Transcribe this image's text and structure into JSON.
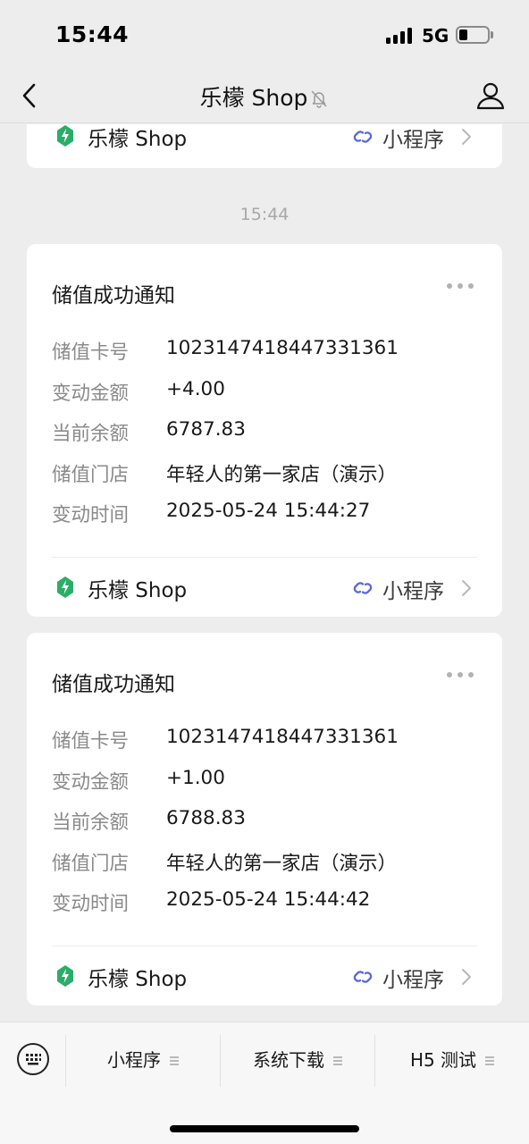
{
  "status_bar": {
    "time": "15:44",
    "network": "5G",
    "icons": [
      "signal-icon",
      "battery-icon"
    ]
  },
  "nav": {
    "title": "乐檬 Shop",
    "icons": [
      "back-icon",
      "mute-bell-icon",
      "person-icon"
    ]
  },
  "chat": {
    "top_card": {
      "miniprogram_name": "乐檬 Shop",
      "miniprogram_tag": "小程序"
    },
    "timestamp": "15:44",
    "messages": [
      {
        "title": "储值成功通知",
        "fields": [
          {
            "label": "储值卡号",
            "value": "1023147418447331361"
          },
          {
            "label": "变动金额",
            "value": "+4.00"
          },
          {
            "label": "当前余额",
            "value": "6787.83"
          },
          {
            "label": "储值门店",
            "value": "年轻人的第一家店（演示）"
          },
          {
            "label": "变动时间",
            "value": "2025-05-24 15:44:27"
          }
        ],
        "miniprogram_name": "乐檬 Shop",
        "miniprogram_tag": "小程序"
      },
      {
        "title": "储值成功通知",
        "fields": [
          {
            "label": "储值卡号",
            "value": "1023147418447331361"
          },
          {
            "label": "变动金额",
            "value": "+1.00"
          },
          {
            "label": "当前余额",
            "value": "6788.83"
          },
          {
            "label": "储值门店",
            "value": "年轻人的第一家店（演示）"
          },
          {
            "label": "变动时间",
            "value": "2025-05-24 15:44:42"
          }
        ],
        "miniprogram_name": "乐檬 Shop",
        "miniprogram_tag": "小程序"
      }
    ]
  },
  "bottom_menu": {
    "items": [
      {
        "label": "小程序"
      },
      {
        "label": "系统下载"
      },
      {
        "label": "H5 测试"
      }
    ]
  },
  "colors": {
    "background": "#ededed",
    "card": "#ffffff",
    "logo_green": "#2aae67",
    "link_blue": "#5b6bd8",
    "label_gray": "#8a8a8a"
  }
}
